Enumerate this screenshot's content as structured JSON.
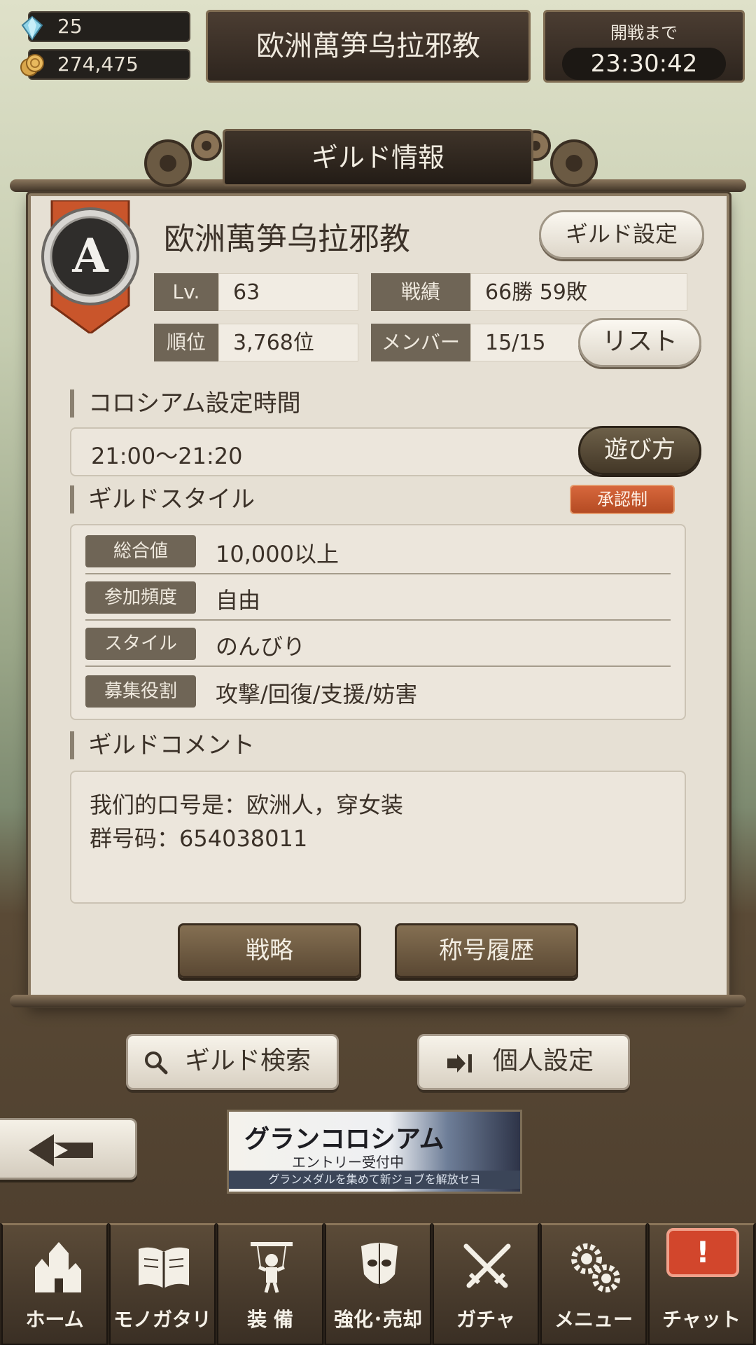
{
  "currency": {
    "gems": "25",
    "coins": "274,475"
  },
  "top": {
    "title": "欧洲萬笋乌拉邪教",
    "countdown_label": "開戦まで",
    "countdown_time": "23:30:42"
  },
  "panel": {
    "header": "ギルド情報",
    "emblem_letter": "A",
    "guild_name": "欧洲萬笋乌拉邪教",
    "settings_button": "ギルド設定",
    "stats": {
      "level_label": "Lv.",
      "level_value": "63",
      "record_label": "戦績",
      "record_value": "66勝  59敗",
      "rank_label": "順位",
      "rank_value": "3,768位",
      "members_label": "メンバー",
      "members_value": "15/15"
    },
    "list_button": "リスト",
    "colosseum_title": "コロシアム設定時間",
    "colosseum_time": "21:00～21:20",
    "howto_button": "遊び方",
    "style_title": "ギルドスタイル",
    "approval_badge": "承認制",
    "style_rows": [
      {
        "label": "総合値",
        "value": "10,000以上"
      },
      {
        "label": "参加頻度",
        "value": "自由"
      },
      {
        "label": "スタイル",
        "value": "のんびり"
      },
      {
        "label": "募集役割",
        "value": "攻撃/回復/支援/妨害"
      }
    ],
    "comment_title": "ギルドコメント",
    "comment_line1": "我们的口号是：欧洲人，穿女装",
    "comment_line2": "群号码：654038011",
    "strategy_button": "戦略",
    "title_history_button": "称号履歴"
  },
  "actions": {
    "guild_search": "ギルド検索",
    "personal_settings": "個人設定"
  },
  "banner": {
    "title": "グランコロシアム",
    "subtitle": "エントリー受付中",
    "footer": "グランメダルを集めて新ジョブを解放セヨ"
  },
  "nav": {
    "home": "ホーム",
    "story": "モノガタリ",
    "equip": "装 備",
    "enhance": "強化･売却",
    "gacha": "ガチャ",
    "menu": "メニュー",
    "chat": "チャット",
    "chat_alert": "!"
  },
  "colors": {
    "accent_orange": "#c9552b",
    "panel_bg": "#e6e0d4",
    "dark_label": "#6f6556",
    "navbar": "#3a2f24"
  }
}
